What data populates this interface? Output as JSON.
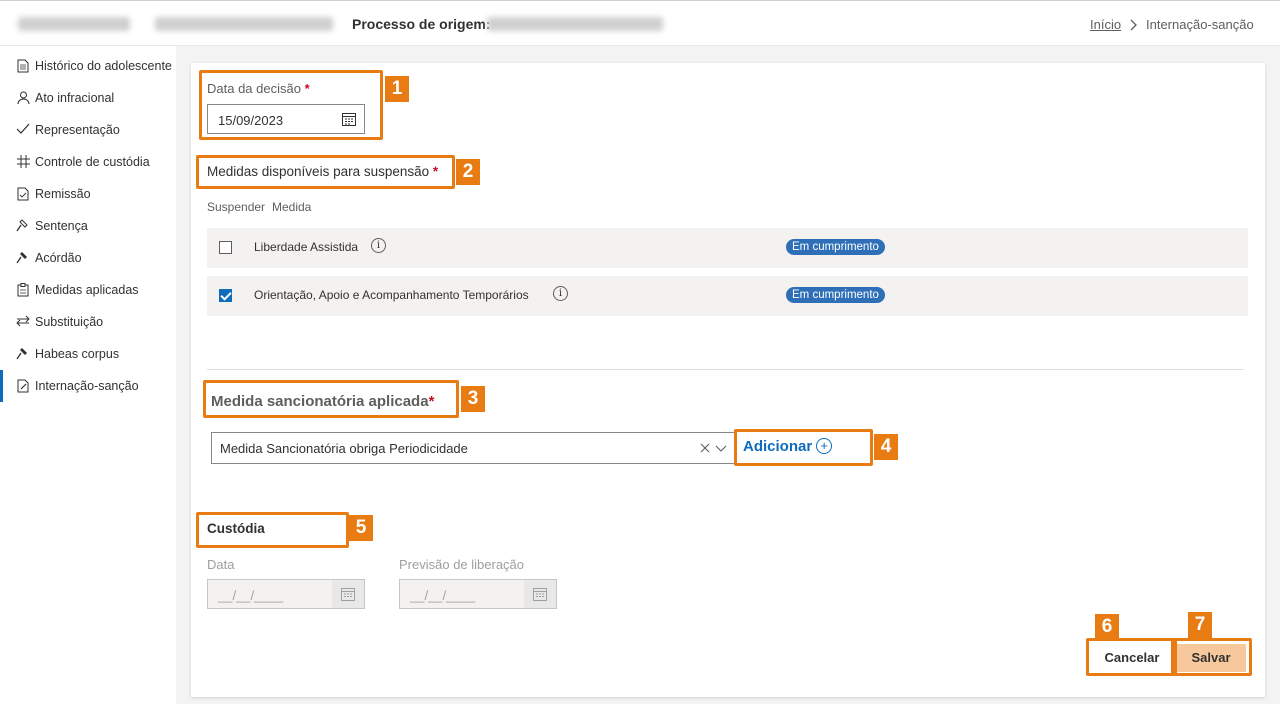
{
  "header": {
    "origin_process_label": "Processo de origem:",
    "breadcrumb_home": "Início",
    "breadcrumb_separator": ">",
    "breadcrumb_current": "Internação-sanção"
  },
  "sidebar": {
    "items": [
      {
        "label": "Histórico do adolescente",
        "icon": "document-icon"
      },
      {
        "label": "Ato infracional",
        "icon": "person-icon"
      },
      {
        "label": "Representação",
        "icon": "checkmark-icon"
      },
      {
        "label": "Controle de custódia",
        "icon": "grid-icon"
      },
      {
        "label": "Remissão",
        "icon": "document-icon"
      },
      {
        "label": "Sentença",
        "icon": "gavel-icon"
      },
      {
        "label": "Acórdão",
        "icon": "gavel-icon"
      },
      {
        "label": "Medidas aplicadas",
        "icon": "clipboard-icon"
      },
      {
        "label": "Substituição",
        "icon": "swap-icon"
      },
      {
        "label": "Habeas corpus",
        "icon": "gavel-icon"
      },
      {
        "label": "Internação-sanção",
        "icon": "edit-document-icon",
        "active": true
      }
    ]
  },
  "form": {
    "decision_date_label": "Data da decisão",
    "required_mark": "*",
    "decision_date_value": "15/09/2023",
    "available_measures_label": "Medidas disponíveis para suspensão",
    "col_suspend": "Suspender",
    "col_measure": "Medida",
    "measures": [
      {
        "name": "Liberdade Assistida",
        "status": "Em cumprimento",
        "checked": false
      },
      {
        "name": "Orientação, Apoio e Acompanhamento Temporários",
        "status": "Em cumprimento",
        "checked": true
      }
    ],
    "sanction_label": "Medida sancionatória aplicada",
    "sanction_value": "Medida Sancionatória obriga Periodicidade",
    "add_label": "Adicionar",
    "custody_title": "Custódia",
    "custody_date_label": "Data",
    "custody_date_placeholder": "__/__/____",
    "custody_release_label": "Previsão de liberação",
    "custody_release_placeholder": "__/__/____",
    "cancel_label": "Cancelar",
    "save_label": "Salvar"
  },
  "annotations": [
    "1",
    "2",
    "3",
    "4",
    "5",
    "6",
    "7"
  ],
  "colors": {
    "accent": "#0f6cbd",
    "highlight": "#e87b12",
    "badge": "#2f6fb7",
    "save_button": "#f7c89b"
  }
}
